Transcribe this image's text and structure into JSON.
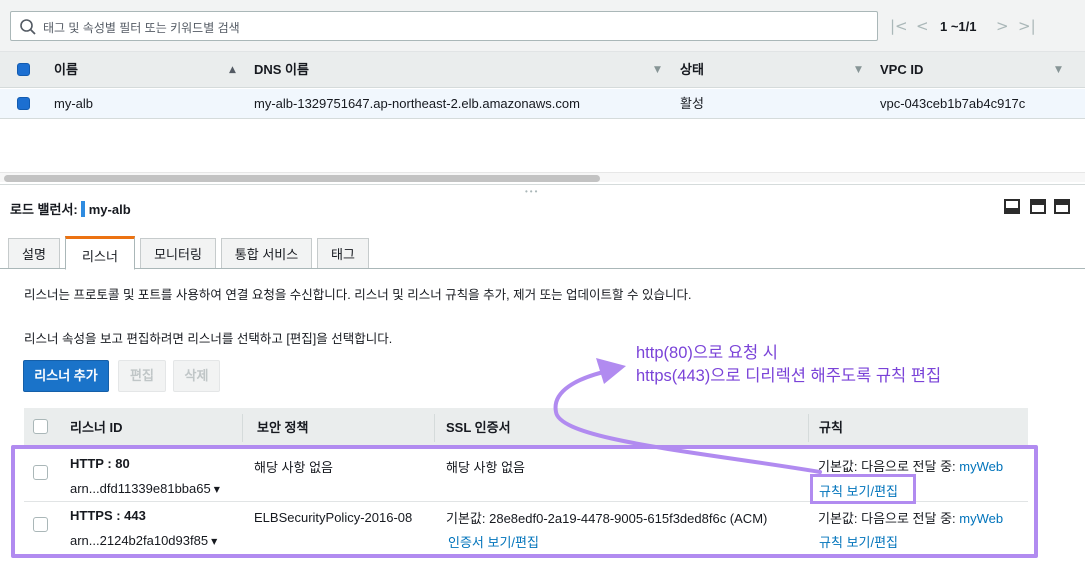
{
  "search": {
    "placeholder": "태그 및 속성별 필터 또는 키워드별 검색"
  },
  "pager": {
    "label": "1 ~1/1",
    "first": "|<",
    "prev": "<",
    "next": ">",
    "last": ">|"
  },
  "lb_table": {
    "columns": [
      "이름",
      "DNS 이름",
      "상태",
      "VPC ID"
    ],
    "rows": [
      {
        "name": "my-alb",
        "dns": "my-alb-1329751647.ap-northeast-2.elb.amazonaws.com",
        "state": "활성",
        "vpc": "vpc-043ceb1b7ab4c917c"
      }
    ]
  },
  "detail": {
    "title_prefix": "로드 밸런서:",
    "title_name": "my-alb",
    "tabs": [
      "설명",
      "리스너",
      "모니터링",
      "통합 서비스",
      "태그"
    ],
    "active_tab": "리스너",
    "desc1": "리스너는 프로토콜 및 포트를 사용하여 연결 요청을 수신합니다. 리스너 및 리스너 규칙을 추가, 제거 또는 업데이트할 수 있습니다.",
    "desc2": "리스너 속성을 보고 편집하려면 리스너를 선택하고 [편집]을 선택합니다.",
    "buttons": {
      "add": "리스너 추가",
      "edit": "편집",
      "delete": "삭제"
    }
  },
  "listeners": {
    "columns": [
      "리스너 ID",
      "보안 정책",
      "SSL 인증서",
      "규칙"
    ],
    "rows": [
      {
        "id": "HTTP : 80",
        "arn": "arn...dfd11339e81bba65",
        "policy": "해당 사항 없음",
        "cert": "해당 사항 없음",
        "cert_link": "",
        "rule_prefix": "기본값:  다음으로 전달 중:",
        "rule_target": "myWeb",
        "rule_link": "규칙 보기/편집"
      },
      {
        "id": "HTTPS : 443",
        "arn": "arn...2124b2fa10d93f85",
        "policy": "ELBSecurityPolicy-2016-08",
        "cert": "기본값:  28e8edf0-2a19-4478-9005-615f3ded8f6c (ACM)",
        "cert_link": "인증서 보기/편집",
        "rule_prefix": "기본값:  다음으로 전달 중:",
        "rule_target": "myWeb",
        "rule_link": "규칙 보기/편집"
      }
    ]
  },
  "annotation": {
    "line1": "http(80)으로 요청 시",
    "line2": "https(443)으로 디리렉션 해주도록 규칙 편집",
    "color": "#b18bf0"
  },
  "colors": {
    "primary": "#1a73c9",
    "link": "#0073bb",
    "tab_accent": "#ec7211",
    "selected_row": "#f1f7fd"
  }
}
